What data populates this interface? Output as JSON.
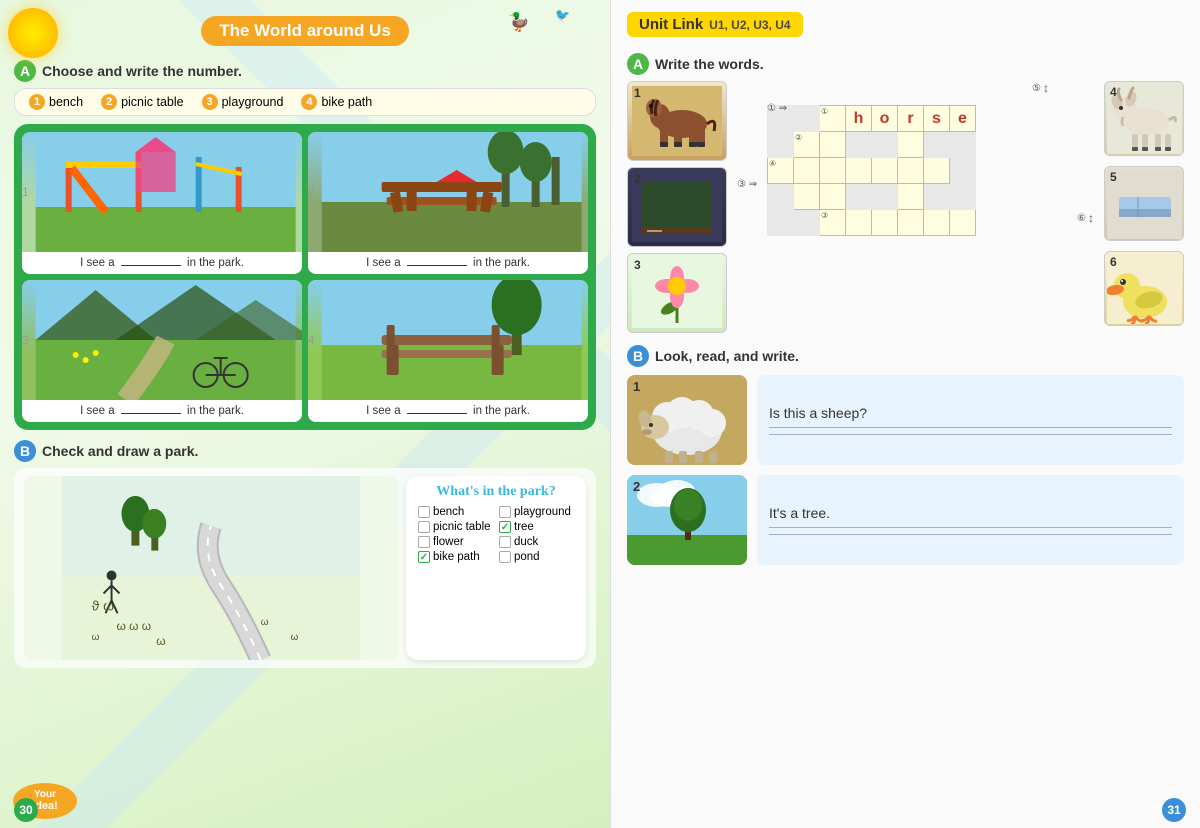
{
  "left_page": {
    "title": "The World around Us",
    "section_a_label": "A",
    "section_a_instruction": "Choose and write the number.",
    "vocab": [
      {
        "num": "1",
        "word": "bench"
      },
      {
        "num": "2",
        "word": "picnic table"
      },
      {
        "num": "3",
        "word": "playground"
      },
      {
        "num": "4",
        "word": "bike path"
      }
    ],
    "grid_items": [
      {
        "num": "1",
        "type": "playground",
        "caption": "I see a",
        "blank": "",
        "suffix": "in the park."
      },
      {
        "num": "2",
        "type": "park-table",
        "caption": "I see a",
        "blank": "",
        "suffix": "in the park."
      },
      {
        "num": "3",
        "type": "bike-path",
        "caption": "I see a",
        "blank": "",
        "suffix": "in the park."
      },
      {
        "num": "4",
        "type": "bench",
        "caption": "I see a",
        "blank": "",
        "suffix": "in the park."
      }
    ],
    "section_b_label": "B",
    "section_b_instruction": "Check and draw a park.",
    "park_title": "What's in the park?",
    "check_items": [
      {
        "label": "bench",
        "checked": false
      },
      {
        "label": "playground",
        "checked": false
      },
      {
        "label": "picnic table",
        "checked": false
      },
      {
        "label": "tree",
        "checked": true
      },
      {
        "label": "flower",
        "checked": false
      },
      {
        "label": "duck",
        "checked": false
      },
      {
        "label": "bike path",
        "checked": true
      },
      {
        "label": "pond",
        "checked": false
      }
    ],
    "page_num": "30",
    "your_idea": "Your idea!"
  },
  "right_page": {
    "unit_link_title": "Unit Link",
    "unit_link_units": "U1, U2, U3, U4",
    "section_a_label": "A",
    "section_a_instruction": "Write the words.",
    "crossword": {
      "letters": [
        "h",
        "o",
        "r",
        "s",
        "e"
      ],
      "clues": {
        "1across": {
          "num": 1,
          "row": 0,
          "col": 0,
          "word": "horse"
        },
        "2down": {
          "num": 2
        },
        "3across": {
          "num": 3
        },
        "4down": {
          "num": 4
        },
        "5down": {
          "num": 5
        },
        "6down": {
          "num": 6
        }
      }
    },
    "images_left": [
      {
        "num": "1",
        "alt": "horse",
        "type": "horse"
      },
      {
        "num": "2",
        "alt": "blackboard",
        "type": "board"
      },
      {
        "num": "3",
        "alt": "flower",
        "type": "flower"
      }
    ],
    "images_right": [
      {
        "num": "4",
        "alt": "goat",
        "type": "goat"
      },
      {
        "num": "5",
        "alt": "eraser",
        "type": "eraser"
      },
      {
        "num": "6",
        "alt": "duck",
        "type": "duck"
      }
    ],
    "section_b_label": "B",
    "section_b_instruction": "Look, read, and write.",
    "lrs_items": [
      {
        "num": "1",
        "type": "sheep",
        "question": "Is this a sheep?",
        "answer": ""
      },
      {
        "num": "2",
        "type": "tree-field",
        "question": "It's a tree.",
        "answer": ""
      }
    ],
    "page_num": "31"
  }
}
